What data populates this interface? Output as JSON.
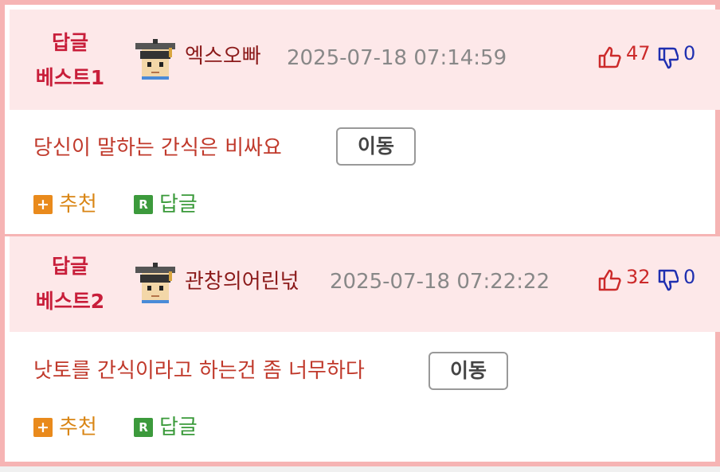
{
  "colors": {
    "border": "#f6b4b4",
    "header_bg": "#fde8e9",
    "rank": "#c81e3a",
    "username": "#8b1a1a",
    "comment": "#c0392b",
    "up": "#cc2a2a",
    "down": "#1f2fb0",
    "recommend": "#d98514",
    "reply": "#3a9a3a"
  },
  "icons": {
    "avatar": "graduate-avatar-icon",
    "up": "thumbs-up-icon",
    "down": "thumbs-down-icon",
    "recommend": "plus-icon",
    "reply": "r-icon"
  },
  "entries": [
    {
      "rank_line1": "답글",
      "rank_line2": "베스트1",
      "username": "엑스오빠",
      "timestamp": "2025-07-18 07:14:59",
      "up_count": "47",
      "down_count": "0",
      "comment": "당신이 말하는 간식은 비싸요",
      "move_label": "이동",
      "recommend_label": "추천",
      "reply_label": "답글"
    },
    {
      "rank_line1": "답글",
      "rank_line2": "베스트2",
      "username": "관창의어린넋",
      "timestamp": "2025-07-18 07:22:22",
      "up_count": "32",
      "down_count": "0",
      "comment": "낫토를 간식이라고 하는건 좀 너무하다",
      "move_label": "이동",
      "recommend_label": "추천",
      "reply_label": "답글"
    }
  ]
}
